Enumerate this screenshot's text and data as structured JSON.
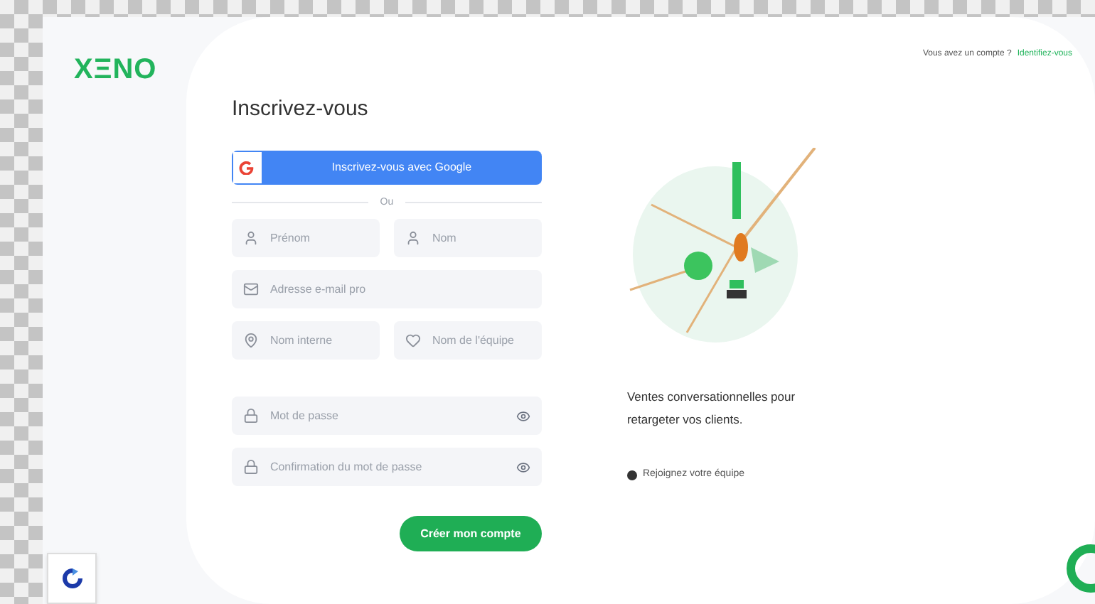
{
  "header": {
    "logo": "XΞNO",
    "account_prompt": "Vous avez un compte ?",
    "login_link": "Identifiez-vous"
  },
  "form": {
    "title": "Inscrivez-vous",
    "google_button": "Inscrivez-vous avec Google",
    "divider": "Ou",
    "field_rows": [
      [
        {
          "kind": "person",
          "placeholder": "Prénom"
        },
        {
          "kind": "person",
          "placeholder": "Nom"
        }
      ],
      [
        {
          "kind": "mail",
          "placeholder": "Adresse e-mail pro"
        }
      ],
      [
        {
          "kind": "pin",
          "placeholder": "Nom interne"
        },
        {
          "kind": "heart",
          "placeholder": "Nom de l'équipe"
        }
      ],
      [
        {
          "kind": "password",
          "placeholder": "Mot de passe"
        }
      ],
      [
        {
          "kind": "password",
          "placeholder": "Confirmation du mot de passe"
        }
      ]
    ],
    "submit": "Créer mon compte"
  },
  "promo": {
    "headline": "Ventes conversationnelles pour retargeter vos clients.",
    "team_link": "Rejoignez votre équipe"
  }
}
